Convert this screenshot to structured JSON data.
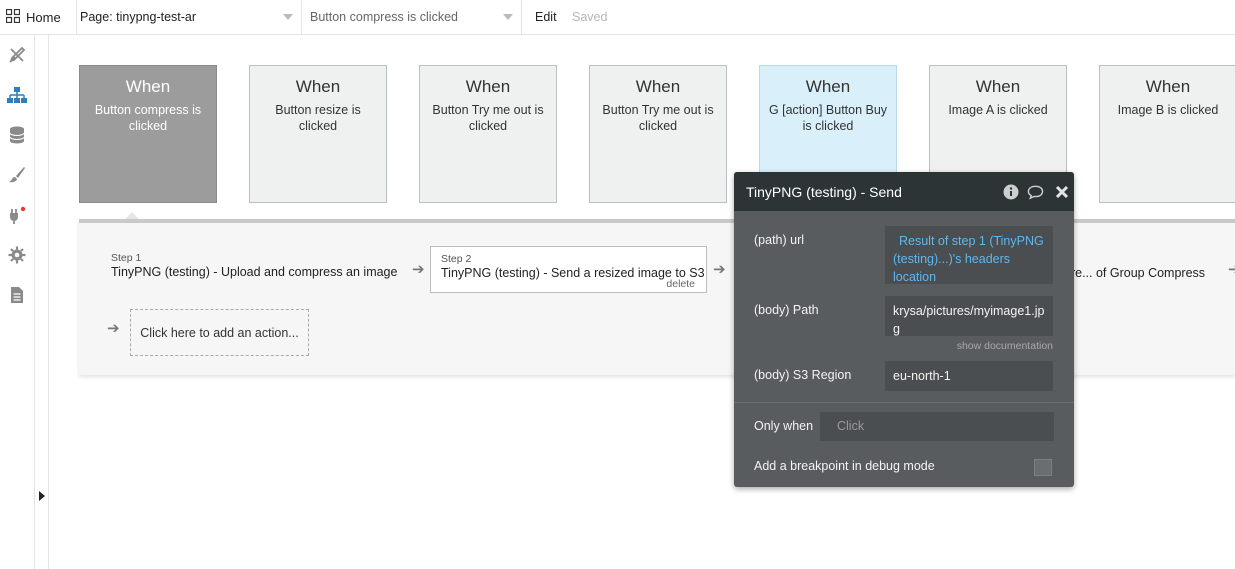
{
  "topbar": {
    "home_label": "Home",
    "page_selector": "Page: tinypng-test-ar",
    "event_selector": "Button compress is clicked",
    "menu_edit": "Edit",
    "menu_saved": "Saved"
  },
  "toolbar": {
    "icons": [
      "design-icon",
      "workflow-icon",
      "data-icon",
      "styles-icon",
      "plugins-icon",
      "settings-icon",
      "logs-icon"
    ],
    "plugins_alert_color": "#e53935"
  },
  "events": [
    {
      "when": "When",
      "desc": "Button compress is clicked"
    },
    {
      "when": "When",
      "desc": "Button resize is clicked"
    },
    {
      "when": "When",
      "desc": "Button Try me out is clicked"
    },
    {
      "when": "When",
      "desc": "Button Try me out is clicked"
    },
    {
      "when": "When",
      "desc": "G [action] Button Buy is clicked"
    },
    {
      "when": "When",
      "desc": "Image A is clicked"
    },
    {
      "when": "When",
      "desc": "Image B is clicked"
    }
  ],
  "steps": {
    "step1_label": "Step 1",
    "step1_text": "TinyPNG (testing) - Upload and compress an image",
    "step2_label": "Step 2",
    "step2_text": "TinyPNG (testing) - Send a resized image to S3",
    "step2_delete": "delete",
    "step_partial": "ore... of Group Compress",
    "add_action": "Click here to add an action..."
  },
  "popup": {
    "title": "TinyPNG (testing) - Send",
    "url_label": "(path) url",
    "url_value": "Result of step 1 (TinyPNG (testing)...)'s headers location",
    "path_label": "(body) Path",
    "path_value": "krysa/pictures/myimage1.jpg",
    "show_doc": "show documentation",
    "region_label": "(body) S3 Region",
    "region_value": "eu-north-1",
    "only_when_label": "Only when",
    "only_when_placeholder": "Click",
    "breakpoint_label": "Add a breakpoint in debug mode"
  },
  "colors": {
    "active_event_bg": "#9c9c9c",
    "highlight_event_bg": "#d9f0fb",
    "popup_bg": "#585c5e",
    "popup_header_bg": "#2d3436",
    "dynamic_link": "#5fb7f0"
  }
}
